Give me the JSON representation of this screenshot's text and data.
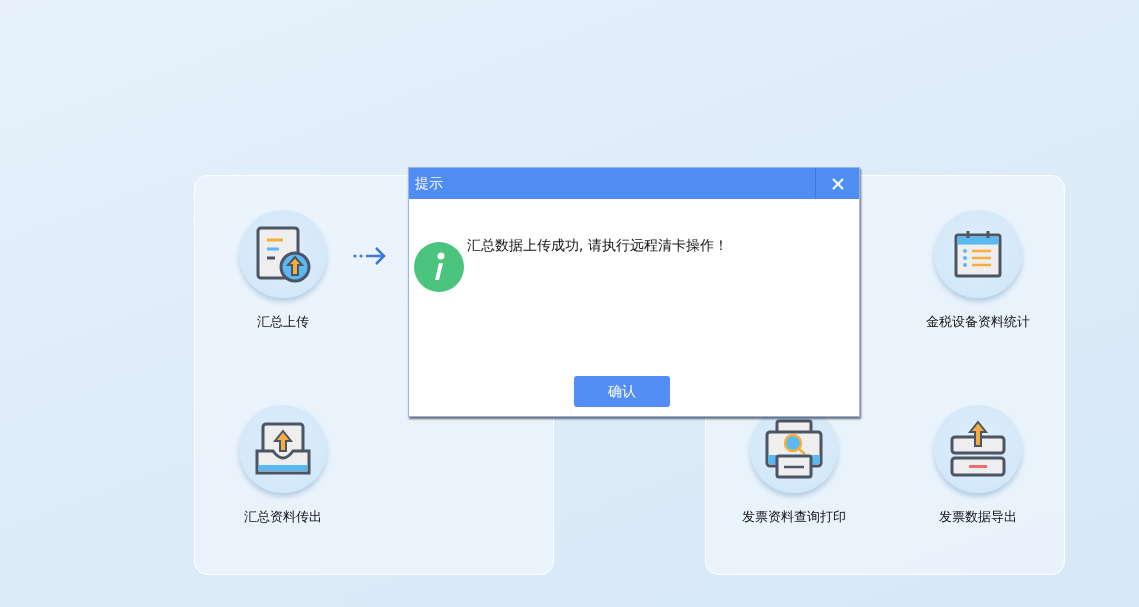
{
  "panels": [
    {
      "items": [
        {
          "label": "汇总上传",
          "kind": "upload"
        },
        {
          "label": "汇总资料传出",
          "kind": "tray"
        }
      ]
    },
    {
      "items": [
        {
          "label": "金税设备资料统计",
          "kind": "calendar"
        },
        {
          "label": "发票资料查询打印",
          "kind": "printer"
        },
        {
          "label": "发票数据导出",
          "kind": "export"
        }
      ]
    }
  ],
  "dialog": {
    "title": "提示",
    "message": "汇总数据上传成功, 请执行远程清卡操作！",
    "button": "确认"
  }
}
